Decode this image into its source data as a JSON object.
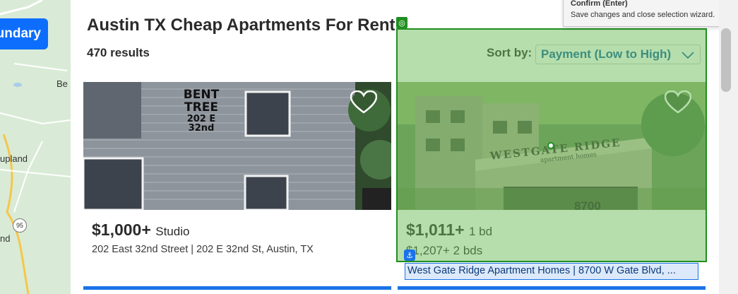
{
  "map": {
    "boundary_button": "undary",
    "labels": [
      "Be",
      "upland",
      "nd"
    ],
    "highway": "95"
  },
  "listing": {
    "title": "Austin TX Cheap Apartments For Rent",
    "results": "470 results",
    "sort_label": "Sort by:",
    "sort_value": "Payment (Low to High)"
  },
  "cards": [
    {
      "price": "$1,000+",
      "beds": "Studio",
      "address": "202 East 32nd Street | 202 E 32nd St, Austin, TX",
      "sign": [
        "BENT",
        "TREE",
        "202 E",
        "32nd"
      ]
    },
    {
      "price": "$1,011+",
      "beds": "1 bd",
      "price2": "$1,207+",
      "beds2": "2 bds",
      "address": "West Gate Ridge Apartment Homes | 8700 W Gate Blvd, ...",
      "sign": [
        "WESTGATE RIDGE",
        "apartment homes",
        "8700"
      ]
    }
  ],
  "tooltip": {
    "title": "Confirm (Enter)",
    "text": "Save changes and close selection wizard."
  },
  "colors": {
    "accent": "#1a73e8",
    "selection": "#1f8f1f",
    "sort_text": "#0b5fa5"
  }
}
